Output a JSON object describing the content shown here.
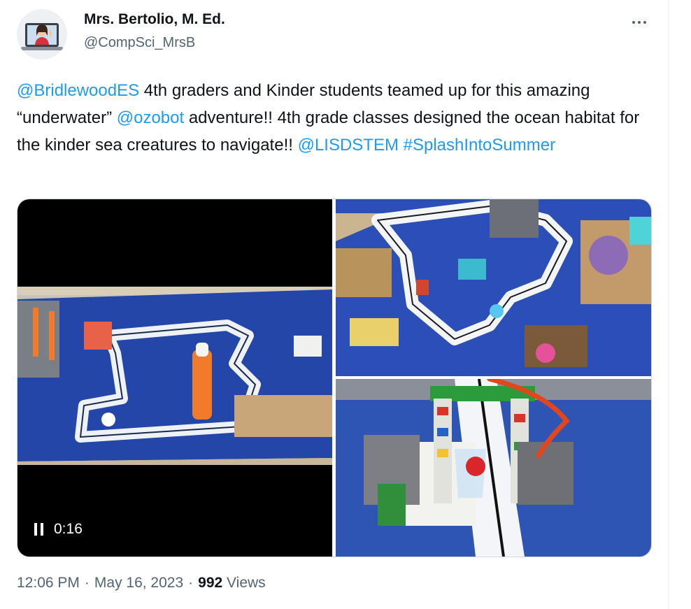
{
  "author": {
    "name": "Mrs. Bertolio, M. Ed.",
    "handle": "@CompSci_MrsB",
    "avatar_icon": "avatar-laptop-teacher-icon"
  },
  "menu": {
    "more_icon": "more-horizontal-icon"
  },
  "tweet": {
    "segments": [
      {
        "text": "@BridlewoodES",
        "link": true
      },
      {
        "text": " 4th graders and Kinder students teamed up for this amazing “underwater” ",
        "link": false
      },
      {
        "text": "@ozobot",
        "link": true
      },
      {
        "text": " adventure!! 4th grade classes designed the ocean habitat for the kinder sea creatures to navigate!! ",
        "link": false
      },
      {
        "text": "@LISDSTEM",
        "link": true
      },
      {
        "text": " ",
        "link": false
      },
      {
        "text": "#SplashIntoSummer",
        "link": true
      }
    ]
  },
  "media": {
    "video": {
      "elapsed": "0:16",
      "state": "playing"
    }
  },
  "footer": {
    "time": "12:06 PM",
    "separator": "·",
    "date": "May 16, 2023",
    "view_count": "992",
    "views_label": "Views"
  },
  "colors": {
    "link": "#1d9bf0",
    "secondary_text": "#536471",
    "primary_text": "#0f1419",
    "border": "#cfd9de"
  }
}
